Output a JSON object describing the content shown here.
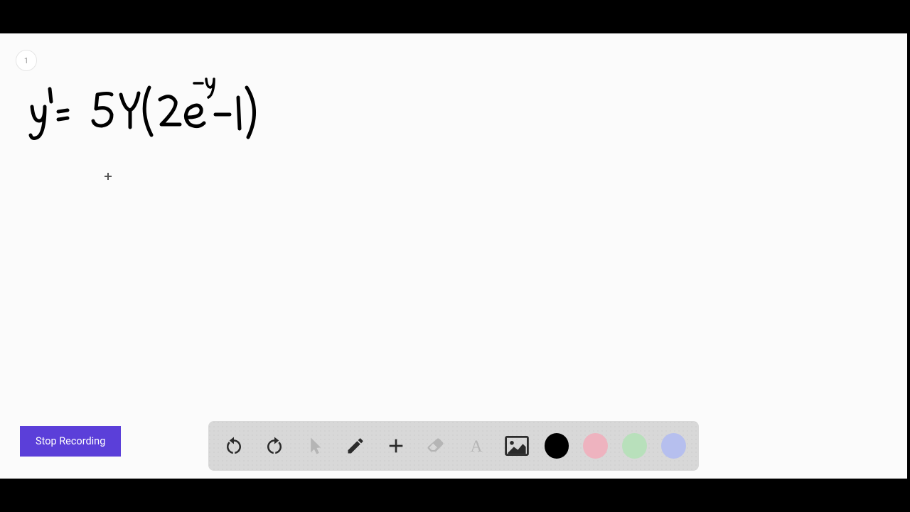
{
  "page": {
    "badge_number": "1"
  },
  "handwriting": {
    "expression": "y' = 5y(2e^{-y} - 1)"
  },
  "controls": {
    "stop_recording_label": "Stop Recording"
  },
  "toolbar": {
    "tools": {
      "undo": "undo-icon",
      "redo": "redo-icon",
      "pointer": "pointer-icon",
      "pencil": "pencil-icon",
      "add": "plus-icon",
      "eraser": "eraser-icon",
      "text": "text-icon",
      "image": "image-icon"
    },
    "colors": {
      "black": "#000000",
      "pink": "#eeb3bf",
      "green": "#b8e0bb",
      "blue": "#b6bfee"
    }
  }
}
